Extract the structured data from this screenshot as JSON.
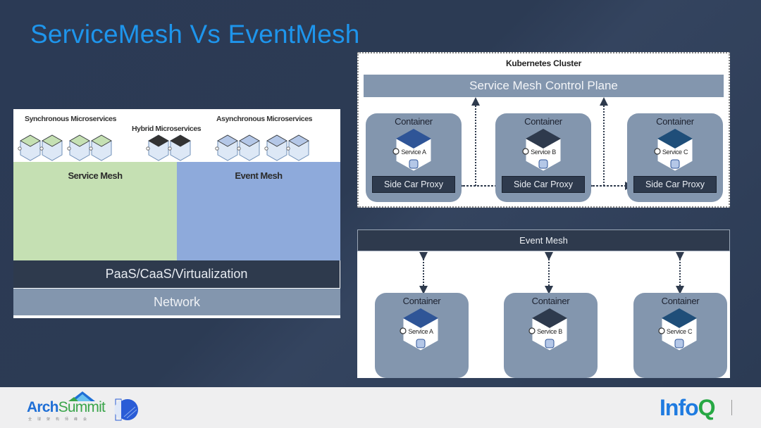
{
  "slide": {
    "title": "ServiceMesh Vs EventMesh"
  },
  "left_diagram": {
    "labels": {
      "synchronous": "Synchronous Microservices",
      "hybrid": "Hybrid Microservices",
      "asynchronous": "Asynchronous Microservices"
    },
    "cube_groups": [
      {
        "name": "synchronous",
        "count": 4,
        "top_color": "#c5e0b3"
      },
      {
        "name": "hybrid",
        "count": 2,
        "top_color": "#333333"
      },
      {
        "name": "asynchronous",
        "count": 4,
        "top_color": "#b4c7e7"
      }
    ],
    "service_mesh": "Service Mesh",
    "event_mesh": "Event Mesh",
    "paas_layer": "PaaS/CaaS/Virtualization",
    "network_layer": "Network"
  },
  "k8s_diagram": {
    "title": "Kubernetes Cluster",
    "control_plane": "Service Mesh Control Plane",
    "containers": [
      {
        "label": "Container",
        "service": "Service A",
        "sidecar": "Side Car Proxy",
        "cube_color": "#2f5597"
      },
      {
        "label": "Container",
        "service": "Service B",
        "sidecar": "Side Car Proxy",
        "cube_color": "#2e3a4d"
      },
      {
        "label": "Container",
        "service": "Service C",
        "sidecar": "Side Car Proxy",
        "cube_color": "#1f4e79"
      }
    ]
  },
  "event_mesh_diagram": {
    "bar": "Event Mesh",
    "containers": [
      {
        "label": "Container",
        "service": "Service A",
        "cube_color": "#2f5597"
      },
      {
        "label": "Container",
        "service": "Service B",
        "cube_color": "#2e3a4d"
      },
      {
        "label": "Container",
        "service": "Service C",
        "cube_color": "#1f4e79"
      }
    ]
  },
  "footer": {
    "archsummit_arch": "Arch",
    "archsummit_summit": "Summit",
    "archsummit_sub": "全球架构师峰会",
    "infoq_info": "Info",
    "infoq_q": "Q"
  },
  "colors": {
    "title": "#1e95ec",
    "service_mesh": "#c5e0b3",
    "event_mesh": "#8eaadb",
    "dark_layer": "#2e3a4d",
    "gray_layer": "#8396ae"
  }
}
